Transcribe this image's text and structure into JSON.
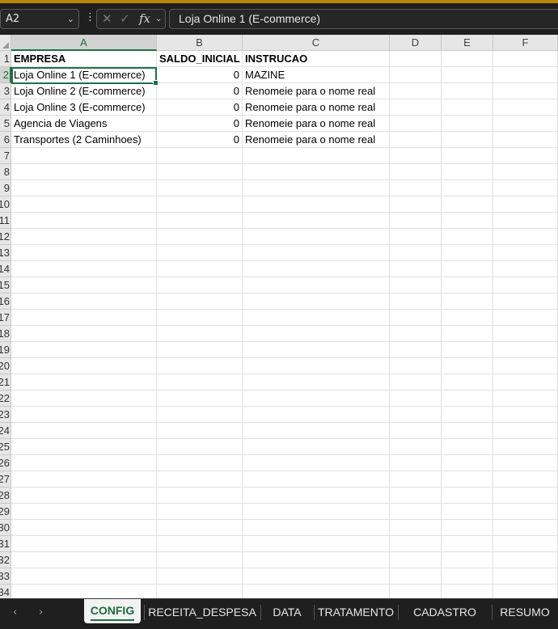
{
  "formula_bar": {
    "name_box": "A2",
    "content": "Loja Online 1 (E-commerce)"
  },
  "columns": [
    "A",
    "B",
    "C",
    "D",
    "E",
    "F"
  ],
  "rows": [
    "1",
    "2",
    "3",
    "4",
    "5",
    "6",
    "7",
    "8",
    "9",
    "10",
    "11",
    "12",
    "13",
    "14",
    "15",
    "16",
    "17",
    "18",
    "19",
    "20",
    "21",
    "22",
    "23",
    "24",
    "25",
    "26",
    "27",
    "28",
    "29",
    "30",
    "31",
    "32",
    "33",
    "34"
  ],
  "cells": {
    "A1": "EMPRESA",
    "B1": "SALDO_INICIAL",
    "C1": "INSTRUCAO",
    "A2": "Loja Online 1 (E-commerce)",
    "B2": "0",
    "C2": "MAZINE",
    "A3": "Loja Online 2 (E-commerce)",
    "B3": "0",
    "C3": "Renomeie para o nome real",
    "A4": "Loja Online 3 (E-commerce)",
    "B4": "0",
    "C4": "Renomeie para o nome real",
    "A5": "Agencia de Viagens",
    "B5": "0",
    "C5": "Renomeie para o nome real",
    "A6": "Transportes (2 Caminhoes)",
    "B6": "0",
    "C6": "Renomeie para o nome real"
  },
  "sheet_tabs": [
    "CONFIG",
    "RECEITA_DESPESA",
    "DATA",
    "TRATAMENTO",
    "CADASTRO",
    "RESUMO"
  ],
  "active_sheet": "CONFIG",
  "colors": {
    "accent": "#1e7145"
  },
  "icons": {
    "cancel": "✕",
    "enter": "✓",
    "function": "fx",
    "dropdown": "⌄",
    "more": "⋮",
    "prev": "‹",
    "next": "›"
  }
}
